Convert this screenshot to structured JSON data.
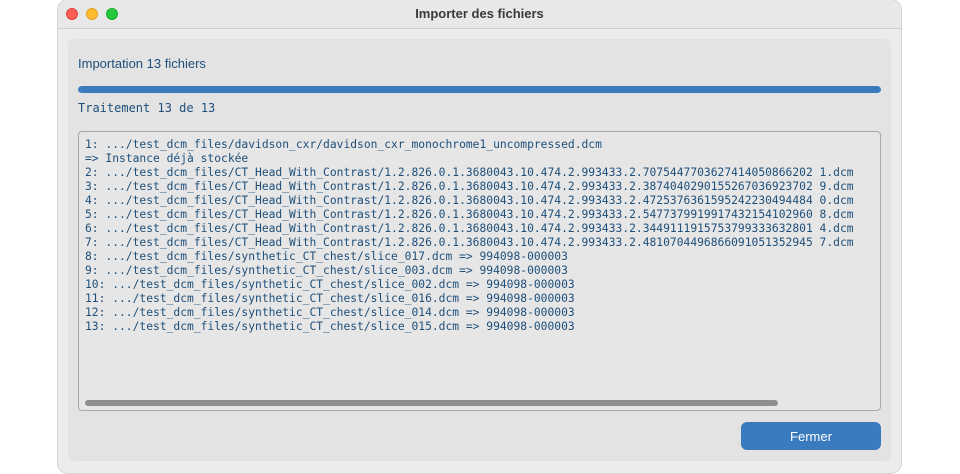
{
  "window": {
    "title": "Importer des fichiers"
  },
  "import": {
    "header": "Importation 13 fichiers",
    "progress_fraction": 1.0,
    "status": "Traitement 13 de 13"
  },
  "log": {
    "lines": [
      "1: .../test_dcm_files/davidson_cxr/davidson_cxr_monochrome1_uncompressed.dcm",
      "=> Instance déjà stockée",
      "2: .../test_dcm_files/CT_Head_With_Contrast/1.2.826.0.1.3680043.10.474.2.993433.2.7075447703627414050866202 1.dcm",
      "3: .../test_dcm_files/CT_Head_With_Contrast/1.2.826.0.1.3680043.10.474.2.993433.2.3874040290155267036923702 9.dcm",
      "4: .../test_dcm_files/CT_Head_With_Contrast/1.2.826.0.1.3680043.10.474.2.993433.2.4725376361595242230494484 0.dcm",
      "5: .../test_dcm_files/CT_Head_With_Contrast/1.2.826.0.1.3680043.10.474.2.993433.2.5477379919917432154102960 8.dcm",
      "6: .../test_dcm_files/CT_Head_With_Contrast/1.2.826.0.1.3680043.10.474.2.993433.2.3449111915753799333632801 4.dcm",
      "7: .../test_dcm_files/CT_Head_With_Contrast/1.2.826.0.1.3680043.10.474.2.993433.2.4810704496866091051352945 7.dcm",
      "8: .../test_dcm_files/synthetic_CT_chest/slice_017.dcm => 994098-000003",
      "9: .../test_dcm_files/synthetic_CT_chest/slice_003.dcm => 994098-000003",
      "10: .../test_dcm_files/synthetic_CT_chest/slice_002.dcm => 994098-000003",
      "11: .../test_dcm_files/synthetic_CT_chest/slice_016.dcm => 994098-000003",
      "12: .../test_dcm_files/synthetic_CT_chest/slice_014.dcm => 994098-000003",
      "13: .../test_dcm_files/synthetic_CT_chest/slice_015.dcm => 994098-000003"
    ]
  },
  "buttons": {
    "close_label": "Fermer"
  },
  "colors": {
    "accent": "#3a7abf",
    "text": "#1e4f7a"
  }
}
